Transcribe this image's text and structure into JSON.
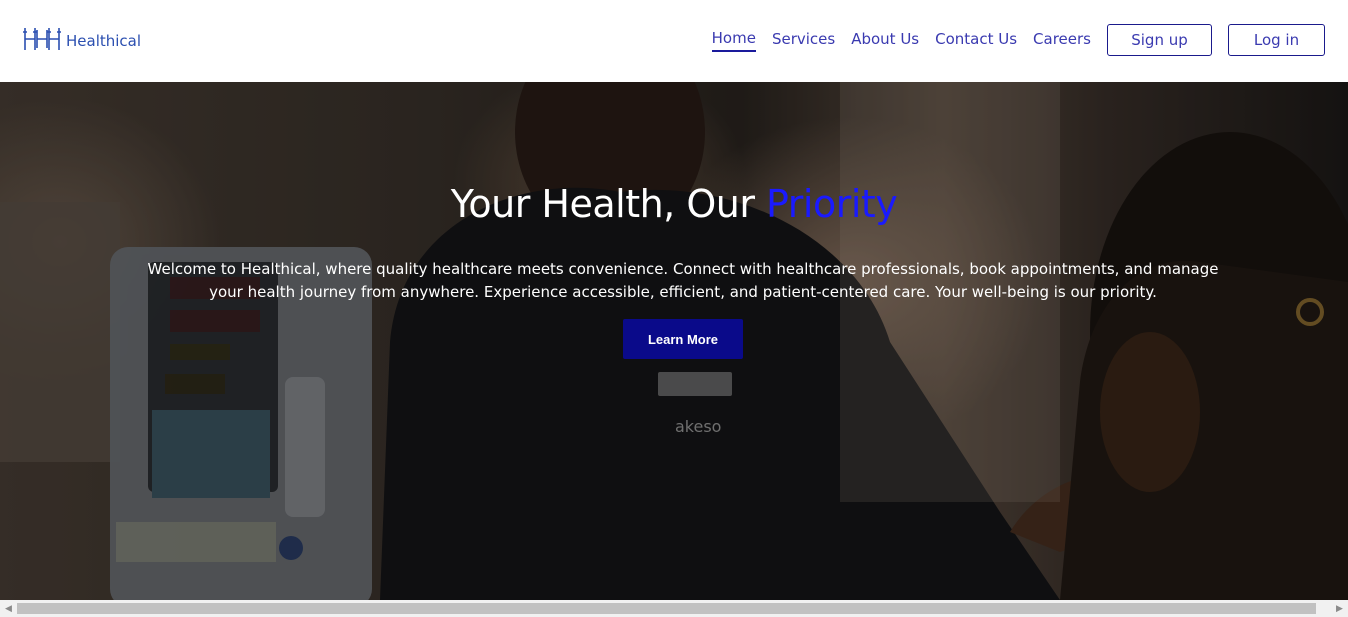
{
  "brand": {
    "name": "Healthical",
    "logo_icon": "hhh-logo-icon"
  },
  "nav": {
    "links": [
      {
        "label": "Home",
        "active": true
      },
      {
        "label": "Services",
        "active": false
      },
      {
        "label": "About Us",
        "active": false
      },
      {
        "label": "Contact Us",
        "active": false
      },
      {
        "label": "Careers",
        "active": false
      }
    ],
    "signup_label": "Sign up",
    "login_label": "Log in"
  },
  "hero": {
    "title_main": "Your Health, Our ",
    "title_accent": "Priority",
    "description": "Welcome to Healthical, where quality healthcare meets convenience. Connect with healthcare professionals, book appointments, and manage your health journey from anywhere. Experience accessible, efficient, and patient-centered care. Your well-being is our priority.",
    "cta_label": "Learn More",
    "photo_badge_text": "akeso"
  },
  "colors": {
    "accent": "#1a1aff",
    "nav_text": "#3a3ab0",
    "cta_bg": "#0a0a8a",
    "brand": "#2b4fb0"
  }
}
